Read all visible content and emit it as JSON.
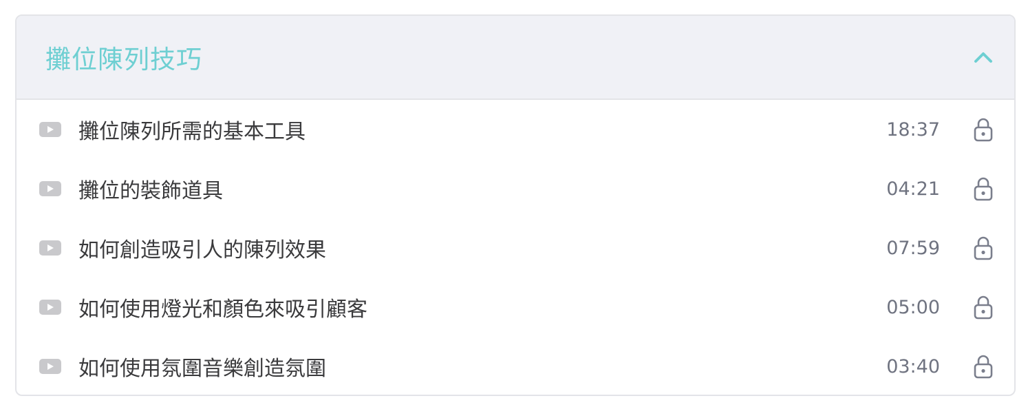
{
  "section": {
    "title": "攤位陳列技巧",
    "expanded": true,
    "toggle_icon": "chevron-up-icon",
    "accent_color": "#6ecfd2"
  },
  "lessons": [
    {
      "title": "攤位陳列所需的基本工具",
      "duration": "18:37",
      "icon": "play-icon",
      "status_icon": "lock-icon"
    },
    {
      "title": "攤位的裝飾道具",
      "duration": "04:21",
      "icon": "play-icon",
      "status_icon": "lock-icon"
    },
    {
      "title": "如何創造吸引人的陳列效果",
      "duration": "07:59",
      "icon": "play-icon",
      "status_icon": "lock-icon"
    },
    {
      "title": "如何使用燈光和顏色來吸引顧客",
      "duration": "05:00",
      "icon": "play-icon",
      "status_icon": "lock-icon"
    },
    {
      "title": "如何使用氛圍音樂創造氛圍",
      "duration": "03:40",
      "icon": "play-icon",
      "status_icon": "lock-icon"
    }
  ]
}
